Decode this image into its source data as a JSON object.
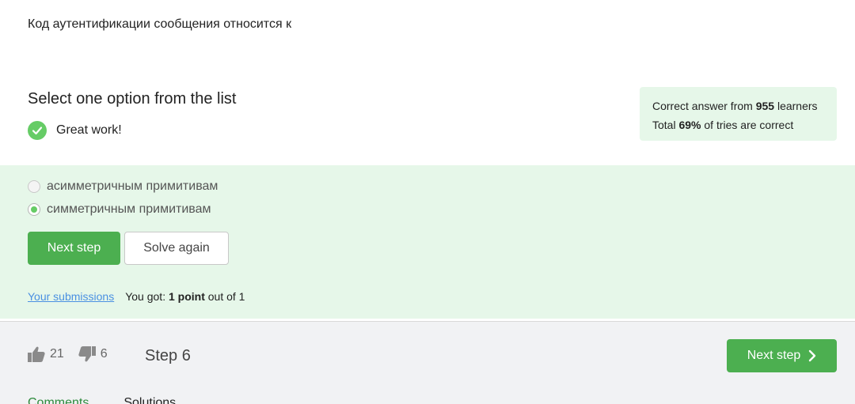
{
  "question": {
    "text": "Код аутентификации сообщения относится к"
  },
  "quiz": {
    "title": "Select one option from the list",
    "feedback": "Great work!"
  },
  "stats": {
    "line1_prefix": "Correct answer from ",
    "learners_count": "955",
    "line1_suffix": " learners",
    "line2_prefix": "Total ",
    "percent": "69%",
    "line2_suffix": " of tries are correct"
  },
  "options": [
    {
      "label": "асимметричным примитивам",
      "selected": false
    },
    {
      "label": "симметричным примитивам",
      "selected": true
    }
  ],
  "buttons": {
    "next_step": "Next step",
    "solve_again": "Solve again"
  },
  "submissions": {
    "link_label": "Your submissions",
    "got_prefix": "You got: ",
    "points": "1 point",
    "got_suffix": " out of 1"
  },
  "footer": {
    "likes": "21",
    "dislikes": "6",
    "step_label": "Step 6",
    "next_step": "Next step",
    "tabs": [
      {
        "label": "Comments",
        "active": true
      },
      {
        "label": "Solutions",
        "active": false
      }
    ]
  },
  "colors": {
    "accent": "#4caf50",
    "success_bg": "#e6f7e9",
    "link": "#4a90e2"
  },
  "icons": {
    "check": "check-icon",
    "like": "thumbs-up-icon",
    "dislike": "thumbs-down-icon",
    "next": "chevron-right-icon"
  }
}
